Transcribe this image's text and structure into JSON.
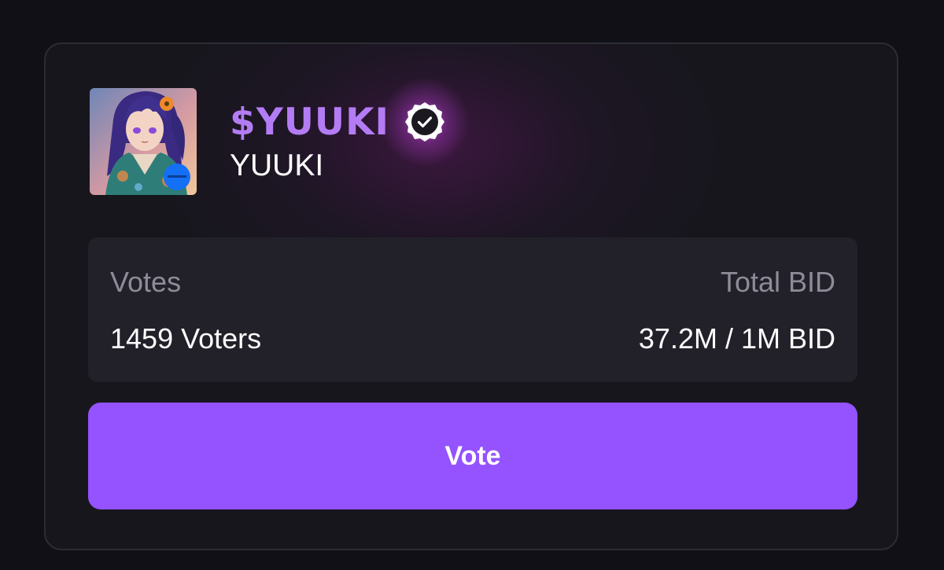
{
  "token": {
    "ticker": "$YUUKI",
    "name": "YUUKI",
    "verified_icon": "verified-check-icon",
    "avatar_icon": "token-avatar"
  },
  "stats": {
    "votes_label": "Votes",
    "voters_value": "1459 Voters",
    "total_bid_label": "Total BID",
    "total_bid_value": "37.2M / 1M BID"
  },
  "actions": {
    "vote_label": "Vote"
  },
  "colors": {
    "background": "#101016",
    "card": "#17161d",
    "accent": "#9453fe",
    "ticker": "#b47cf4",
    "muted_text": "#8e8c98"
  }
}
